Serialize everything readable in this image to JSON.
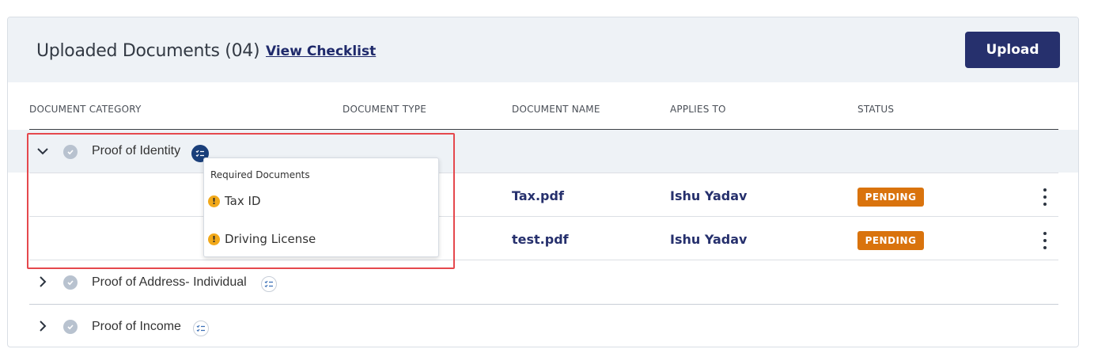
{
  "header": {
    "title": "Uploaded Documents (04)",
    "checklist_link": "View Checklist",
    "upload_label": "Upload"
  },
  "columns": [
    "DOCUMENT CATEGORY",
    "DOCUMENT TYPE",
    "DOCUMENT NAME",
    "APPLIES TO",
    "STATUS"
  ],
  "groups": [
    {
      "label": "Proof of Identity",
      "expanded": true,
      "rows": [
        {
          "document_name": "Tax.pdf",
          "applies_to": "Ishu Yadav",
          "status": "PENDING"
        },
        {
          "document_name": "test.pdf",
          "applies_to": "Ishu Yadav",
          "status": "PENDING"
        }
      ]
    },
    {
      "label": "Proof of Address- Individual",
      "expanded": false
    },
    {
      "label": "Proof of Income",
      "expanded": false
    }
  ],
  "popover": {
    "title": "Required Documents",
    "items": [
      "Tax ID",
      "Driving License"
    ]
  },
  "colors": {
    "primary": "#26306d",
    "pending_badge": "#d9730d",
    "warning": "#f2a91a",
    "highlight_border": "#e5484d",
    "header_bg": "#eef2f6"
  }
}
